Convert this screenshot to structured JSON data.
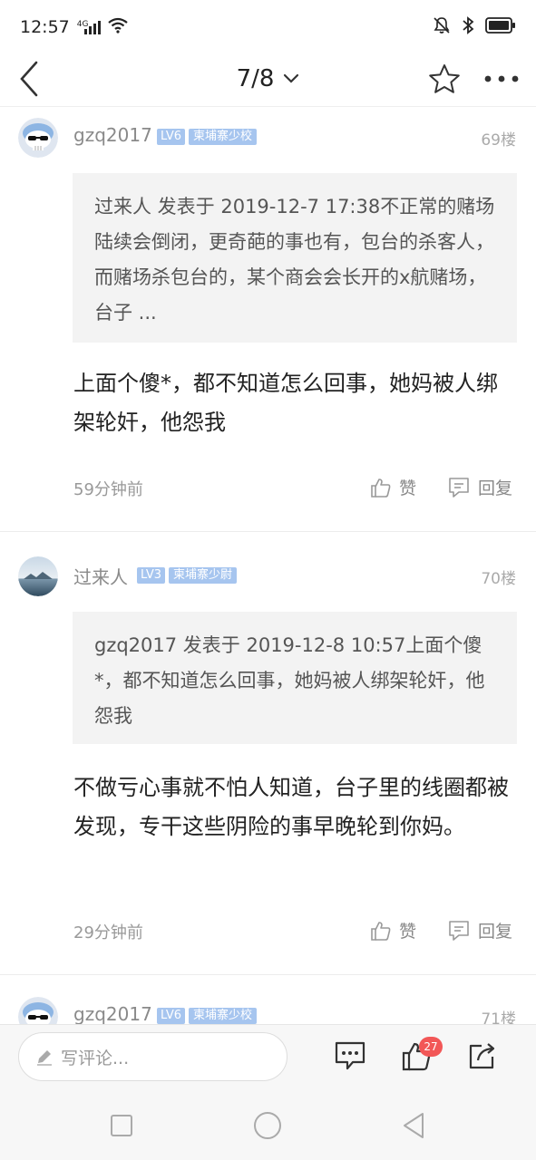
{
  "status_bar": {
    "time": "12:57",
    "network": "4G"
  },
  "nav": {
    "page_indicator": "7/8"
  },
  "posts": [
    {
      "username": "gzq2017",
      "level": "LV6",
      "rank": "柬埔寨少校",
      "floor": "69楼",
      "quote": "过来人 发表于 2019-12-7 17:38不正常的赌场陆续会倒闭，更奇葩的事也有，包台的杀客人，而赌场杀包台的，某个商会会长开的x航赌场，台子 ...",
      "reply": "上面个傻*，都不知道怎么回事，她妈被人绑架轮奸，他怨我",
      "time": "59分钟前",
      "like_label": "赞",
      "reply_label": "回复"
    },
    {
      "username": "过来人",
      "level": "LV3",
      "rank": "柬埔寨少尉",
      "floor": "70楼",
      "quote": "gzq2017 发表于 2019-12-8 10:57上面个傻*，都不知道怎么回事，她妈被人绑架轮奸，他怨我",
      "reply": "不做亏心事就不怕人知道，台子里的线圈都被发现，专干这些阴险的事早晚轮到你妈。",
      "time": "29分钟前",
      "like_label": "赞",
      "reply_label": "回复"
    },
    {
      "username": "gzq2017",
      "level": "LV6",
      "rank": "柬埔寨少校",
      "floor": "71楼"
    }
  ],
  "bottom_bar": {
    "comment_placeholder": "写评论...",
    "like_count": "27"
  },
  "colors": {
    "badge": "#a6c5ef",
    "like_badge": "#f25757",
    "quote_bg": "#f3f3f3"
  },
  "icons": [
    "back-arrow-icon",
    "chevron-down-icon",
    "star-icon",
    "more-icon",
    "thumbs-up-icon",
    "comment-icon",
    "pencil-icon",
    "share-icon"
  ]
}
